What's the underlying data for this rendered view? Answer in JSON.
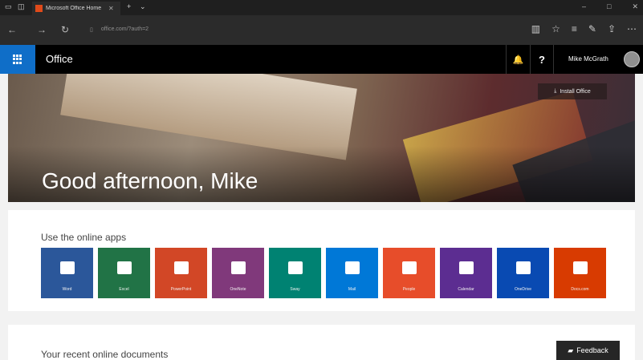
{
  "browser": {
    "tab_title": "Microsoft Office Home",
    "tab_close": "✕",
    "new_tab": "+",
    "tab_menu": "⌄",
    "url": "office.com/?auth=2",
    "nav_back": "←",
    "nav_forward": "→",
    "nav_refresh": "↻",
    "win_min": "–",
    "win_max": "□",
    "win_close": "✕"
  },
  "office_bar": {
    "brand": "Office",
    "user_name": "Mike McGrath",
    "help": "?",
    "bell": "🔔"
  },
  "hero": {
    "greeting": "Good afternoon, Mike",
    "install_label": "Install Office"
  },
  "apps": {
    "heading": "Use the online apps",
    "tiles": [
      {
        "label": "Word",
        "color": "#2b579a"
      },
      {
        "label": "Excel",
        "color": "#217346"
      },
      {
        "label": "PowerPoint",
        "color": "#d24726"
      },
      {
        "label": "OneNote",
        "color": "#80397b"
      },
      {
        "label": "Sway",
        "color": "#008272"
      },
      {
        "label": "Mail",
        "color": "#0078d7"
      },
      {
        "label": "People",
        "color": "#e74d2a"
      },
      {
        "label": "Calendar",
        "color": "#5c2d91"
      },
      {
        "label": "OneDrive",
        "color": "#094ab2"
      },
      {
        "label": "Docs.com",
        "color": "#d83b01"
      }
    ]
  },
  "recent": {
    "heading": "Your recent online documents"
  },
  "feedback": {
    "label": "Feedback"
  }
}
